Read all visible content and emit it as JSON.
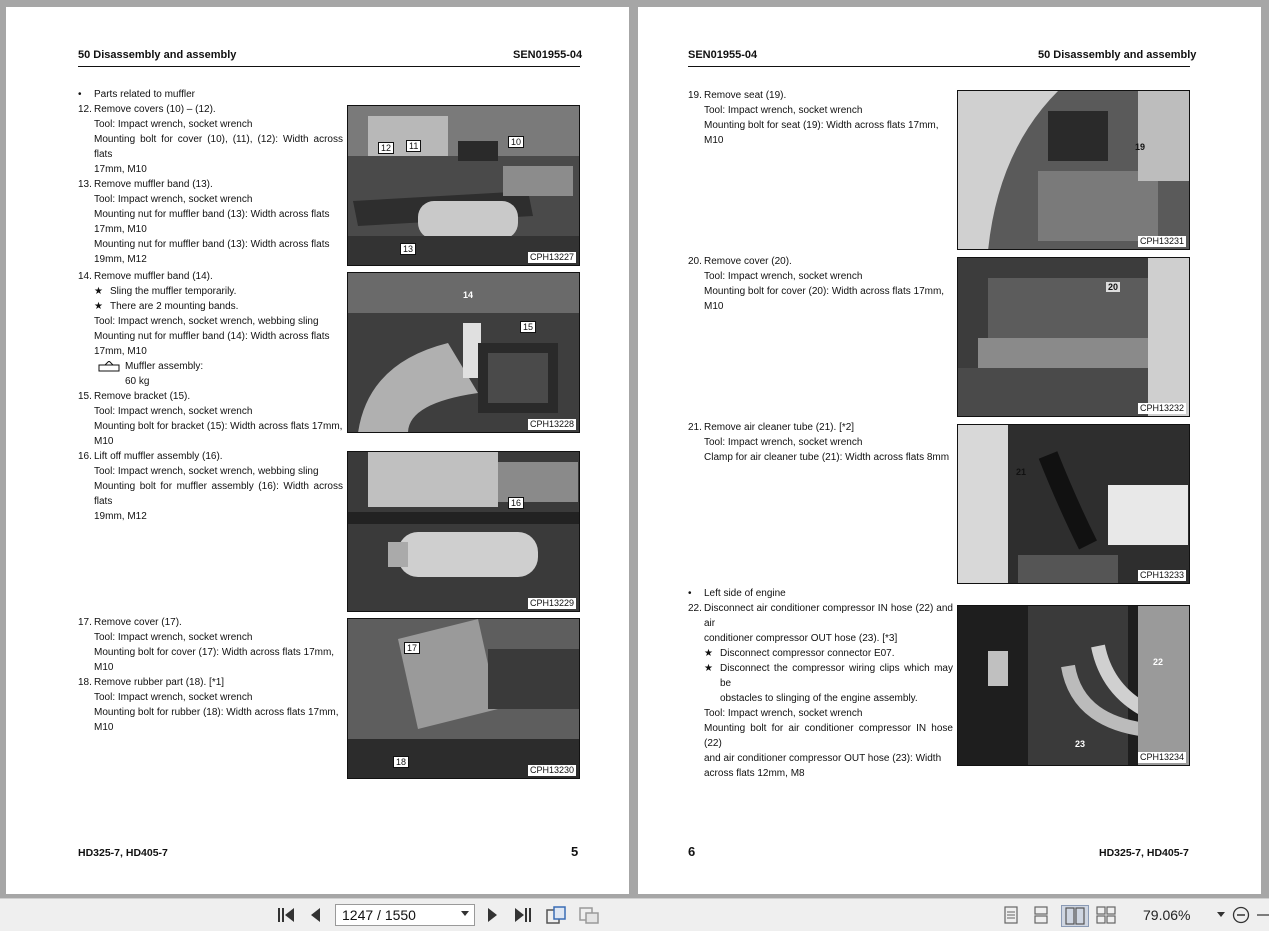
{
  "left_page": {
    "header_left": "50 Disassembly and assembly",
    "header_right": "SEN01955-04",
    "footer_left": "HD325-7, HD405-7",
    "page_number": "5",
    "bullet_parts": "Parts related to muffler",
    "s12": {
      "num": "12.",
      "title": "Remove covers (10) – (12).",
      "tool": "Tool: Impact wrench, socket wrench",
      "line1": "Mounting bolt for cover (10), (11), (12): Width across flats",
      "line2": "17mm, M10"
    },
    "s13": {
      "num": "13.",
      "title": "Remove muffler band (13).",
      "tool": "Tool: Impact wrench, socket wrench",
      "line1": "Mounting nut for muffler band (13): Width across flats",
      "line2": "17mm, M10",
      "line3": "Mounting nut for muffler band (13): Width across flats",
      "line4": "19mm, M12"
    },
    "s14": {
      "num": "14.",
      "title": "Remove muffler band (14).",
      "star1": "Sling the muffler temporarily.",
      "star2": "There are 2 mounting bands.",
      "tool": "Tool: Impact wrench, socket wrench, webbing sling",
      "line1": "Mounting nut for muffler band (14): Width across flats",
      "line2": "17mm, M10",
      "weight_label": "Muffler assembly:",
      "weight_value": "60 kg"
    },
    "s15": {
      "num": "15.",
      "title": "Remove bracket (15).",
      "tool": "Tool: Impact wrench, socket wrench",
      "line1": "Mounting bolt for bracket (15): Width across flats 17mm,",
      "line2": "M10"
    },
    "s16": {
      "num": "16.",
      "title": "Lift off muffler assembly (16).",
      "tool": "Tool: Impact wrench, socket wrench, webbing sling",
      "line1": "Mounting bolt for muffler assembly (16): Width across flats",
      "line2": "19mm, M12"
    },
    "s17": {
      "num": "17.",
      "title": "Remove cover (17).",
      "tool": "Tool: Impact wrench, socket wrench",
      "line1": "Mounting bolt for cover (17): Width across flats 17mm, M10"
    },
    "s18": {
      "num": "18.",
      "title": "Remove rubber part (18). [*1]",
      "tool": "Tool: Impact wrench, socket wrench",
      "line1": "Mounting bolt for rubber (18): Width across flats 17mm,",
      "line2": "M10"
    },
    "figures": [
      {
        "code": "CPH13227",
        "callouts": [
          "12",
          "11",
          "10",
          "13"
        ]
      },
      {
        "code": "CPH13228",
        "callouts": [
          "14",
          "15"
        ]
      },
      {
        "code": "CPH13229",
        "callouts": [
          "16"
        ]
      },
      {
        "code": "CPH13230",
        "callouts": [
          "17",
          "18"
        ]
      }
    ]
  },
  "right_page": {
    "header_left": "SEN01955-04",
    "header_right": "50 Disassembly and assembly",
    "footer_right": "HD325-7, HD405-7",
    "page_number": "6",
    "s19": {
      "num": "19.",
      "title": "Remove seat (19).",
      "tool": "Tool: Impact wrench, socket wrench",
      "line1": "Mounting bolt for seat (19): Width across flats 17mm, M10"
    },
    "s20": {
      "num": "20.",
      "title": "Remove cover (20).",
      "tool": "Tool: Impact wrench, socket wrench",
      "line1": "Mounting bolt for cover (20): Width across flats 17mm, M10"
    },
    "s21": {
      "num": "21.",
      "title": "Remove air cleaner tube (21). [*2]",
      "tool": "Tool: Impact wrench, socket wrench",
      "line1": "Clamp for air cleaner tube (21): Width across flats 8mm"
    },
    "bullet_left": "Left side of engine",
    "s22": {
      "num": "22.",
      "title1": "Disconnect air conditioner compressor IN hose (22) and air",
      "title2": "conditioner compressor OUT hose (23). [*3]",
      "star1": "Disconnect compressor connector E07.",
      "star2a": "Disconnect the compressor wiring clips which may be",
      "star2b": "obstacles to slinging of the engine assembly.",
      "tool": "Tool: Impact wrench, socket wrench",
      "line1": "Mounting bolt for air conditioner compressor IN hose (22)",
      "line2": "and air conditioner compressor OUT hose (23): Width",
      "line3": "across flats 12mm, M8"
    },
    "figures": [
      {
        "code": "CPH13231",
        "callouts": [
          "19"
        ]
      },
      {
        "code": "CPH13232",
        "callouts": [
          "20"
        ]
      },
      {
        "code": "CPH13233",
        "callouts": [
          "21"
        ]
      },
      {
        "code": "CPH13234",
        "callouts": [
          "22",
          "23"
        ]
      }
    ]
  },
  "toolbar": {
    "page_input": "1247 / 1550",
    "zoom": "79.06%",
    "icons": [
      "first-page-icon",
      "prev-page-icon",
      "next-page-icon",
      "last-page-icon",
      "rotate-icon",
      "snapshot-icon",
      "single-page-view-icon",
      "continuous-view-icon",
      "two-page-view-icon",
      "two-page-continuous-icon",
      "zoom-out-icon"
    ]
  }
}
